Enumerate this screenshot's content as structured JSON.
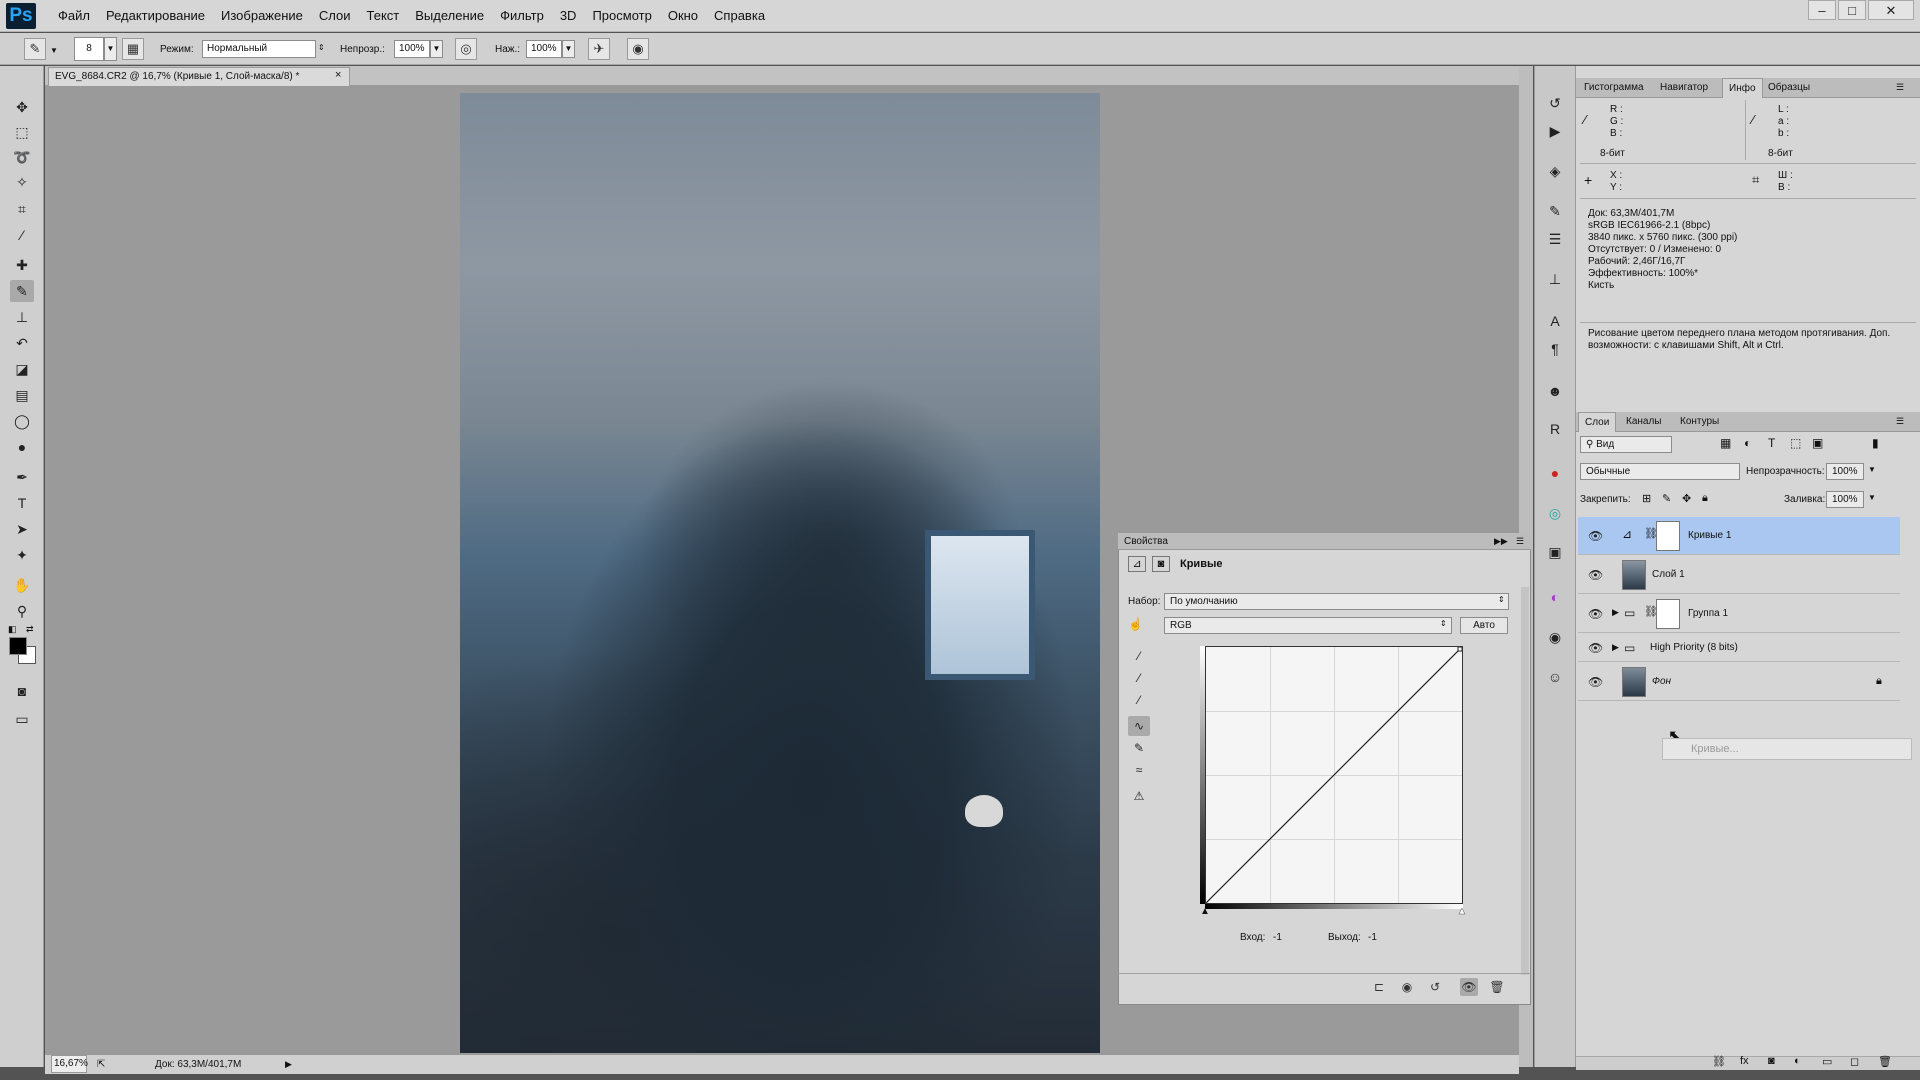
{
  "app": {
    "logo": "Ps"
  },
  "menu": [
    "Файл",
    "Редактирование",
    "Изображение",
    "Слои",
    "Текст",
    "Выделение",
    "Фильтр",
    "3D",
    "Просмотр",
    "Окно",
    "Справка"
  ],
  "window_controls": {
    "minimize": "–",
    "maximize": "□",
    "close": "✕"
  },
  "options": {
    "brush_size": "8",
    "mode_label": "Режим:",
    "mode_value": "Нормальный",
    "opacity_label": "Непрозр.:",
    "opacity_value": "100%",
    "pressure_label": "Наж.:",
    "pressure_value": "100%"
  },
  "document": {
    "tab_title": "EVG_8684.CR2 @ 16,7% (Кривые 1, Слой-маска/8) *",
    "close": "×"
  },
  "statusbar": {
    "zoom": "16,67%",
    "doc_size": "Док: 63,3M/401,7M"
  },
  "info_panel": {
    "tabs": [
      "Гистограмма",
      "Навигатор",
      "Инфо",
      "Образцы"
    ],
    "selected_tab": "Инфо",
    "rgb_labels": [
      "R :",
      "G :",
      "B :"
    ],
    "lab_labels": [
      "L :",
      "a :",
      "b :"
    ],
    "bit_left": "8-бит",
    "bit_right": "8-бит",
    "xy_labels": [
      "X :",
      "Y :"
    ],
    "wh_labels": [
      "Ш :",
      "В :"
    ],
    "doc_info": [
      "Док: 63,3M/401,7M",
      "sRGB IEC61966-2.1 (8bpc)",
      "3840 пикс. x 5760 пикс. (300 ppi)",
      "Отсутствует: 0 / Изменено: 0",
      "Рабочий: 2,46Г/16,7Г",
      "Эффективность: 100%*",
      "Кисть"
    ],
    "hint_line1": "Рисование цветом переднего плана методом протягивания. Доп.",
    "hint_line2": "возможности: с клавишами Shift, Alt и Ctrl."
  },
  "layers_panel": {
    "tabs": [
      "Слои",
      "Каналы",
      "Контуры"
    ],
    "selected_tab": "Слои",
    "filter": "Вид",
    "blend_mode": "Обычные",
    "opacity_label": "Непрозрачность:",
    "opacity_value": "100%",
    "lock_label": "Закрепить:",
    "fill_label": "Заливка:",
    "fill_value": "100%",
    "layers": [
      {
        "name": "Кривые 1",
        "selected": true
      },
      {
        "name": "Слой 1",
        "selected": false
      },
      {
        "name": "Группа 1",
        "selected": false
      },
      {
        "name": "High Priority (8 bits)",
        "selected": false
      },
      {
        "name": "Фон",
        "selected": false
      }
    ],
    "drag_tooltip": "Кривые..."
  },
  "properties": {
    "title": "Свойства",
    "adjustment": "Кривые",
    "preset_label": "Набор:",
    "preset_value": "По умолчанию",
    "channel_value": "RGB",
    "auto_button": "Авто",
    "input_label": "Вход:",
    "input_value": "-1",
    "output_label": "Выход:",
    "output_value": "-1"
  },
  "colors": {
    "foreground": "#000000",
    "background": "#ffffff",
    "selection": "#a9c7f0"
  }
}
